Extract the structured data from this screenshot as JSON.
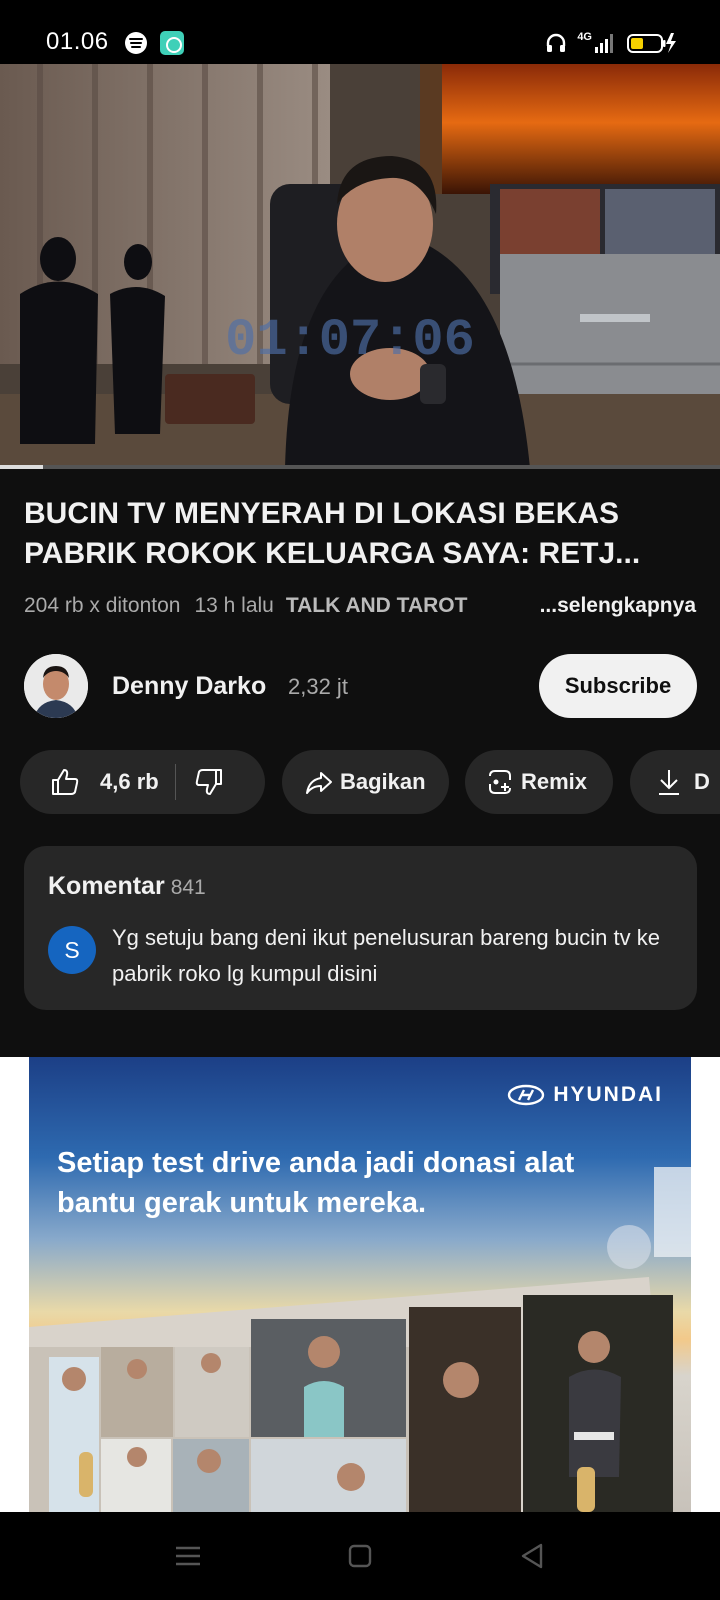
{
  "status_bar": {
    "time": "01.06",
    "network": "4G"
  },
  "video": {
    "overlay_timecode": "01:07:06",
    "progress_fraction": 0.06
  },
  "title_lines": [
    "BUCIN TV MENYERAH DI LOKASI BEKAS",
    "PABRIK ROKOK KELUARGA SAYA: RETJ..."
  ],
  "meta": {
    "views": "204 rb x ditonton",
    "time_ago": "13 h lalu",
    "topic": "TALK AND TAROT",
    "more": "...selengkapnya"
  },
  "channel": {
    "name": "Denny Darko",
    "subscribers": "2,32 jt",
    "subscribe_label": "Subscribe"
  },
  "actions": {
    "likes": "4,6 rb",
    "share": "Bagikan",
    "remix": "Remix",
    "download_partial": "D"
  },
  "comments": {
    "heading": "Komentar",
    "count": "841",
    "top_comment_initial": "S",
    "top_comment_text": "Yg setuju bang deni ikut penelusuran bareng bucin tv ke pabrik roko lg kumpul disini"
  },
  "ad": {
    "brand": "HYUNDAI",
    "headline": "Setiap test drive anda jadi donasi alat bantu gerak untuk mereka."
  },
  "colors": {
    "background": "#0f0f0f",
    "surface": "#272727",
    "subscribe_bg": "#f1f1f1",
    "comment_avatar": "#1565c0"
  }
}
